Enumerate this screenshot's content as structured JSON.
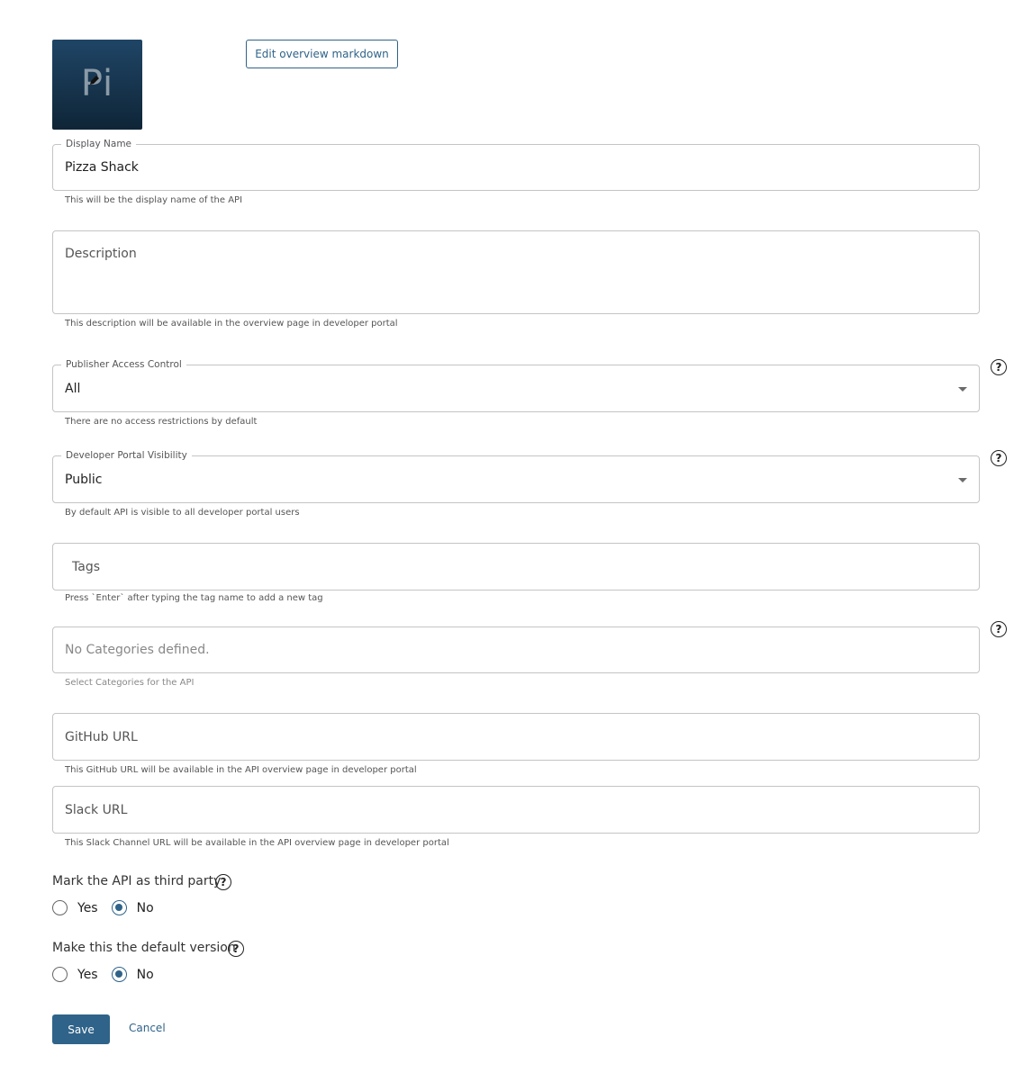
{
  "thumbnail": {
    "text": "Pi",
    "edit_icon": "pencil-icon"
  },
  "overview_button": {
    "label": "Edit overview markdown"
  },
  "display_name": {
    "label": "Display Name",
    "value": "Pizza Shack",
    "helper": "This will be the display name of the API"
  },
  "description": {
    "placeholder": "Description",
    "helper": "This description will be available in the overview page in developer portal"
  },
  "publisher_access": {
    "label": "Publisher Access Control",
    "value": "All",
    "helper": "There are no access restrictions by default",
    "help_icon": "help-circle-icon"
  },
  "portal_visibility": {
    "label": "Developer Portal Visibility",
    "value": "Public",
    "helper": "By default API is visible to all developer portal users",
    "help_icon": "help-circle-icon"
  },
  "tags": {
    "placeholder": "Tags",
    "helper": "Press `Enter` after typing the tag name to add a new tag"
  },
  "categories": {
    "placeholder": "No Categories defined.",
    "helper": "Select Categories for the API",
    "help_icon": "help-circle-icon"
  },
  "github": {
    "placeholder": "GitHub URL",
    "helper": "This GitHub URL will be available in the API overview page in developer portal"
  },
  "slack": {
    "placeholder": "Slack URL",
    "helper": "This Slack Channel URL will be available in the API overview page in developer portal"
  },
  "third_party": {
    "label": "Mark the API as third party",
    "options": [
      "Yes",
      "No"
    ],
    "selected": "No"
  },
  "default_version": {
    "label": "Make this the default version",
    "options": [
      "Yes",
      "No"
    ],
    "selected": "No"
  },
  "actions": {
    "save": "Save",
    "cancel": "Cancel"
  },
  "colors": {
    "primary": "#2f6389",
    "border": "#c4c4c4"
  }
}
